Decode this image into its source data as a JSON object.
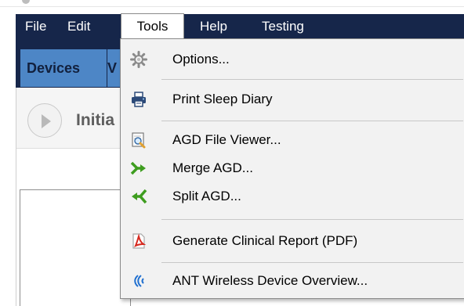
{
  "menubar": {
    "items": [
      "File",
      "Edit",
      "Tools",
      "Help",
      "Testing"
    ]
  },
  "tabs": {
    "devices": "Devices",
    "next_fragment": "V"
  },
  "content": {
    "init_label": "Initia"
  },
  "tools_menu": {
    "items": [
      {
        "label": "Options...",
        "icon": "gear-icon"
      },
      {
        "label": "Print Sleep Diary",
        "icon": "printer-icon"
      },
      {
        "label": "AGD File Viewer...",
        "icon": "file-viewer-icon"
      },
      {
        "label": "Merge AGD...",
        "icon": "merge-icon"
      },
      {
        "label": "Split AGD...",
        "icon": "split-icon"
      },
      {
        "label": "Generate Clinical Report (PDF)",
        "icon": "pdf-icon"
      },
      {
        "label": "ANT Wireless Device Overview...",
        "icon": "wireless-icon"
      }
    ]
  },
  "colors": {
    "menubar_bg": "#16264a",
    "tab_active_bg": "#4d86c6",
    "dropdown_bg": "#f2f2f2"
  }
}
